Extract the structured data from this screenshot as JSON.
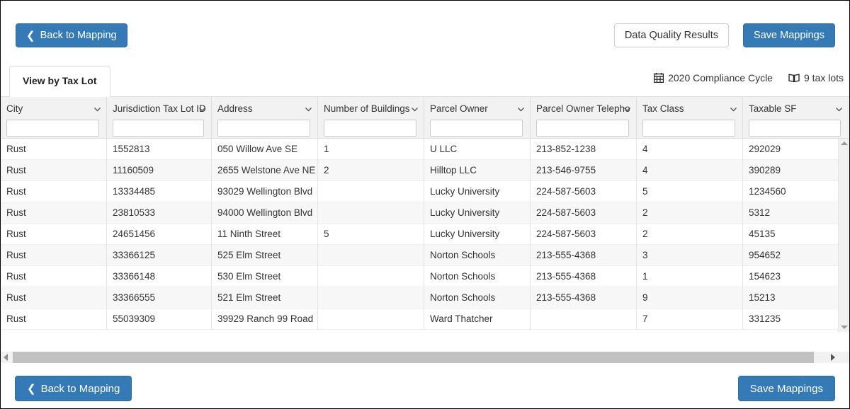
{
  "toolbar": {
    "back_label": "Back to Mapping",
    "data_quality_label": "Data Quality Results",
    "save_label": "Save Mappings"
  },
  "tabs": [
    {
      "label": "View by Tax Lot",
      "active": true
    }
  ],
  "meta": {
    "compliance_cycle": "2020 Compliance Cycle",
    "compliance_cycle_icon": "calendar-icon",
    "tax_lot_count": "9 tax lots",
    "tax_lot_count_icon": "map-book-icon"
  },
  "grid": {
    "columns": [
      {
        "key": "city",
        "label": "City",
        "width_class": "w-city",
        "filter_value": "",
        "truncated": false
      },
      {
        "key": "jtlid",
        "label": "Jurisdiction Tax Lot ID",
        "width_class": "w-jtlid",
        "filter_value": "",
        "truncated": true
      },
      {
        "key": "address",
        "label": "Address",
        "width_class": "w-addr",
        "filter_value": "",
        "truncated": false
      },
      {
        "key": "nbld",
        "label": "Number of Buildings",
        "width_class": "w-nbld",
        "filter_value": "",
        "truncated": false
      },
      {
        "key": "owner",
        "label": "Parcel Owner",
        "width_class": "w-owner",
        "filter_value": "",
        "truncated": false
      },
      {
        "key": "tel",
        "label": "Parcel Owner Telephone",
        "width_class": "w-tel",
        "filter_value": "",
        "truncated": true
      },
      {
        "key": "taxclass",
        "label": "Tax Class",
        "width_class": "w-class",
        "filter_value": "",
        "truncated": false
      },
      {
        "key": "sf",
        "label": "Taxable SF",
        "width_class": "w-sf",
        "filter_value": "",
        "truncated": false
      }
    ],
    "rows": [
      {
        "city": "Rust",
        "jtlid": "1552813",
        "address": "050 Willow Ave SE",
        "nbld": "1",
        "owner": "U LLC",
        "tel": "213-852-1238",
        "taxclass": "4",
        "sf": "292029"
      },
      {
        "city": "Rust",
        "jtlid": "11160509",
        "address": "2655 Welstone Ave NE",
        "nbld": "2",
        "owner": "Hilltop LLC",
        "tel": "213-546-9755",
        "taxclass": "4",
        "sf": "390289"
      },
      {
        "city": "Rust",
        "jtlid": "13334485",
        "address": "93029 Wellington Blvd",
        "nbld": "",
        "owner": "Lucky University",
        "tel": "224-587-5603",
        "taxclass": "5",
        "sf": "1234560"
      },
      {
        "city": "Rust",
        "jtlid": "23810533",
        "address": "94000 Wellington Blvd",
        "nbld": "",
        "owner": "Lucky University",
        "tel": "224-587-5603",
        "taxclass": "2",
        "sf": "5312"
      },
      {
        "city": "Rust",
        "jtlid": "24651456",
        "address": "11 Ninth Street",
        "nbld": "5",
        "owner": "Lucky University",
        "tel": "224-587-5603",
        "taxclass": "2",
        "sf": "45135"
      },
      {
        "city": "Rust",
        "jtlid": "33366125",
        "address": "525 Elm Street",
        "nbld": "",
        "owner": "Norton Schools",
        "tel": "213-555-4368",
        "taxclass": "3",
        "sf": "954652"
      },
      {
        "city": "Rust",
        "jtlid": "33366148",
        "address": "530 Elm Street",
        "nbld": "",
        "owner": "Norton Schools",
        "tel": "213-555-4368",
        "taxclass": "1",
        "sf": "154623"
      },
      {
        "city": "Rust",
        "jtlid": "33366555",
        "address": "521 Elm Street",
        "nbld": "",
        "owner": "Norton Schools",
        "tel": "213-555-4368",
        "taxclass": "9",
        "sf": "15213"
      },
      {
        "city": "Rust",
        "jtlid": "55039309",
        "address": "39929 Ranch 99 Road",
        "nbld": "",
        "owner": "Ward Thatcher",
        "tel": "",
        "taxclass": "7",
        "sf": "331235"
      }
    ],
    "filter_placeholder": ""
  },
  "bottombar": {
    "back_label": "Back to Mapping",
    "save_label": "Save Mappings"
  },
  "colors": {
    "primary": "#337ab7",
    "primary_border": "#2e6da4",
    "header_bg": "#f2f2f2",
    "row_alt_bg": "#f7f7f7",
    "border": "#dddddd",
    "text": "#333333"
  }
}
